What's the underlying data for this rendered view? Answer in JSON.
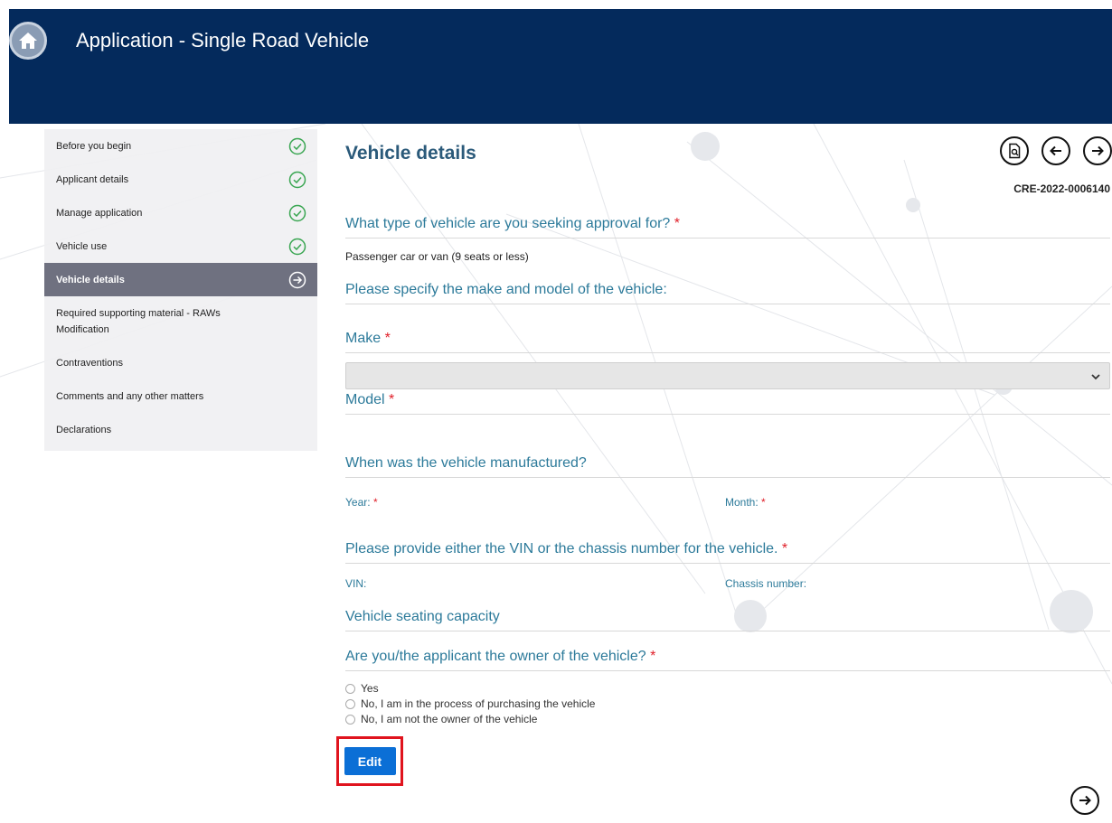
{
  "header": {
    "title": "Application - Single Road Vehicle",
    "home_icon": "home-icon",
    "bg_color": "#042a5c"
  },
  "sidebar": {
    "items": [
      {
        "label": "Before you begin",
        "status": "complete"
      },
      {
        "label": "Applicant details",
        "status": "complete"
      },
      {
        "label": "Manage application",
        "status": "complete"
      },
      {
        "label": "Vehicle use",
        "status": "complete"
      },
      {
        "label": "Vehicle details",
        "status": "current"
      },
      {
        "label": "Required supporting material - RAWs Modification",
        "status": "none"
      },
      {
        "label": "Contraventions",
        "status": "none"
      },
      {
        "label": "Comments and any other matters",
        "status": "none"
      },
      {
        "label": "Declarations",
        "status": "none"
      }
    ],
    "complete_color": "#3aa652",
    "active_bg": "#6f7180"
  },
  "main": {
    "title": "Vehicle details",
    "reference": "CRE-2022-0006140",
    "icons": [
      "document-preview-icon",
      "arrow-left-icon",
      "arrow-right-icon"
    ],
    "q_vehicle_type": "What type of vehicle are you seeking approval for?",
    "vehicle_type_answer": "Passenger car or van (9 seats or less)",
    "q_make_model": "Please specify the make and model of the vehicle:",
    "make_label": "Make",
    "make_value": "",
    "model_label": "Model",
    "q_manufactured": "When was the vehicle manufactured?",
    "year_label": "Year:",
    "month_label": "Month:",
    "q_vin": "Please provide either the VIN or the chassis number for the vehicle.",
    "vin_label": "VIN:",
    "chassis_label": "Chassis number:",
    "q_seating": "Vehicle seating capacity",
    "q_owner": "Are you/the applicant the owner of the vehicle?",
    "owner_options": [
      "Yes",
      "No, I am in the process of purchasing the vehicle",
      "No, I am not the owner of the vehicle"
    ],
    "required_mark": "*",
    "edit_label": "Edit"
  }
}
